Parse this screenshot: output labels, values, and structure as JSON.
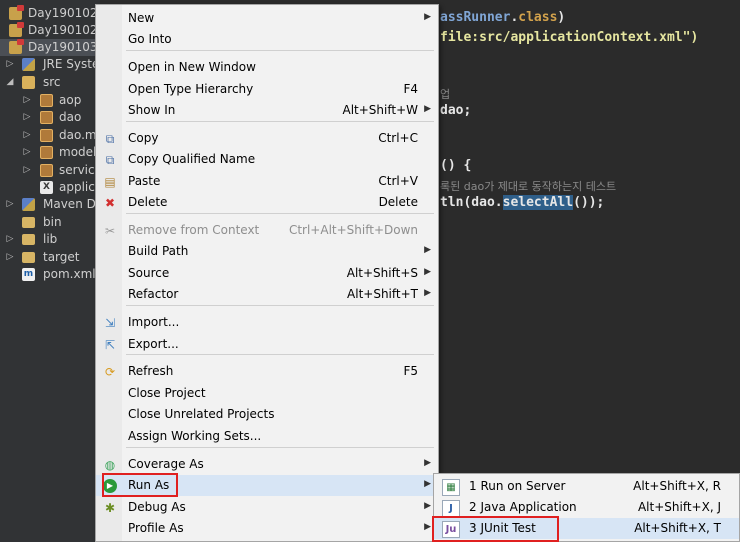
{
  "explorer": {
    "rows": [
      {
        "label": "Day190102_",
        "icon": "project-icon",
        "arrow": ""
      },
      {
        "label": "Day190102_",
        "icon": "project-icon",
        "arrow": ""
      },
      {
        "label": "Day190103_",
        "icon": "project-icon",
        "arrow": "▾",
        "selected": true
      },
      {
        "label": "JRE Syster",
        "icon": "library-icon",
        "arrow": "▷"
      },
      {
        "label": "src",
        "icon": "source-folder-icon",
        "arrow": "◢"
      },
      {
        "label": "aop",
        "icon": "package-icon",
        "arrow": "▷"
      },
      {
        "label": "dao",
        "icon": "package-icon",
        "arrow": "▷"
      },
      {
        "label": "dao.ma",
        "icon": "package-icon",
        "arrow": "▷"
      },
      {
        "label": "model",
        "icon": "package-icon",
        "arrow": "▷"
      },
      {
        "label": "service",
        "icon": "package-icon",
        "arrow": "▷"
      },
      {
        "label": "applica",
        "icon": "xml-file-icon",
        "arrow": ""
      },
      {
        "label": "Maven De",
        "icon": "library-icon",
        "arrow": "▷"
      },
      {
        "label": "bin",
        "icon": "folder-icon",
        "arrow": ""
      },
      {
        "label": "lib",
        "icon": "folder-icon",
        "arrow": "▷"
      },
      {
        "label": "target",
        "icon": "folder-icon",
        "arrow": "▷"
      },
      {
        "label": "pom.xml",
        "icon": "maven-pom-icon",
        "arrow": ""
      }
    ]
  },
  "editor": {
    "line1": {
      "a": "assRunner",
      "b": ".",
      "c": "class",
      "d": ")"
    },
    "line2": {
      "a": "file:src/applicationContext.xml\")"
    },
    "comment1": "업",
    "line3": {
      "a": "dao;"
    },
    "line4": {
      "a": "() {"
    },
    "comment2": "록된 dao가 제대로 동작하는지 테스트",
    "line5": {
      "a": "tln(dao.",
      "b": "selectAll",
      "c": "());"
    }
  },
  "context_menu": {
    "items": [
      {
        "label": "New",
        "shortcut": "",
        "submenu": true,
        "icon": ""
      },
      {
        "label": "Go Into",
        "shortcut": "",
        "submenu": false,
        "icon": ""
      },
      {
        "label": "Open in New Window",
        "shortcut": "",
        "submenu": false,
        "icon": ""
      },
      {
        "label": "Open Type Hierarchy",
        "shortcut": "F4",
        "submenu": false,
        "icon": ""
      },
      {
        "label": "Show In",
        "shortcut": "Alt+Shift+W",
        "submenu": true,
        "icon": ""
      },
      {
        "label": "Copy",
        "shortcut": "Ctrl+C",
        "submenu": false,
        "icon": "copy-icon"
      },
      {
        "label": "Copy Qualified Name",
        "shortcut": "",
        "submenu": false,
        "icon": "copy-qualified-icon"
      },
      {
        "label": "Paste",
        "shortcut": "Ctrl+V",
        "submenu": false,
        "icon": "paste-icon"
      },
      {
        "label": "Delete",
        "shortcut": "Delete",
        "submenu": false,
        "icon": "delete-icon"
      },
      {
        "label": "Remove from Context",
        "shortcut": "Ctrl+Alt+Shift+Down",
        "submenu": false,
        "icon": "remove-context-icon",
        "disabled": true
      },
      {
        "label": "Build Path",
        "shortcut": "",
        "submenu": true,
        "icon": ""
      },
      {
        "label": "Source",
        "shortcut": "Alt+Shift+S",
        "submenu": true,
        "icon": ""
      },
      {
        "label": "Refactor",
        "shortcut": "Alt+Shift+T",
        "submenu": true,
        "icon": ""
      },
      {
        "label": "Import...",
        "shortcut": "",
        "submenu": false,
        "icon": "import-icon"
      },
      {
        "label": "Export...",
        "shortcut": "",
        "submenu": false,
        "icon": "export-icon"
      },
      {
        "label": "Refresh",
        "shortcut": "F5",
        "submenu": false,
        "icon": "refresh-icon"
      },
      {
        "label": "Close Project",
        "shortcut": "",
        "submenu": false,
        "icon": ""
      },
      {
        "label": "Close Unrelated Projects",
        "shortcut": "",
        "submenu": false,
        "icon": ""
      },
      {
        "label": "Assign Working Sets...",
        "shortcut": "",
        "submenu": false,
        "icon": ""
      },
      {
        "label": "Coverage As",
        "shortcut": "",
        "submenu": true,
        "icon": "coverage-icon"
      },
      {
        "label": "Run As",
        "shortcut": "",
        "submenu": true,
        "icon": "run-icon",
        "active": true
      },
      {
        "label": "Debug As",
        "shortcut": "",
        "submenu": true,
        "icon": "debug-icon"
      },
      {
        "label": "Profile As",
        "shortcut": "",
        "submenu": true,
        "icon": ""
      }
    ]
  },
  "run_as_submenu": {
    "items": [
      {
        "label": "1 Run on Server",
        "shortcut": "Alt+Shift+X, R",
        "icon": "server-icon"
      },
      {
        "label": "2 Java Application",
        "shortcut": "Alt+Shift+X, J",
        "icon": "java-app-icon"
      },
      {
        "label": "3 JUnit Test",
        "shortcut": "Alt+Shift+X, T",
        "icon": "junit-icon",
        "active": true
      }
    ]
  },
  "colors": {
    "editor_bg": "#2b2b2b",
    "menu_bg": "#f2f2f2",
    "highlight": "#d7e5f5",
    "annotation": "#e02020"
  }
}
